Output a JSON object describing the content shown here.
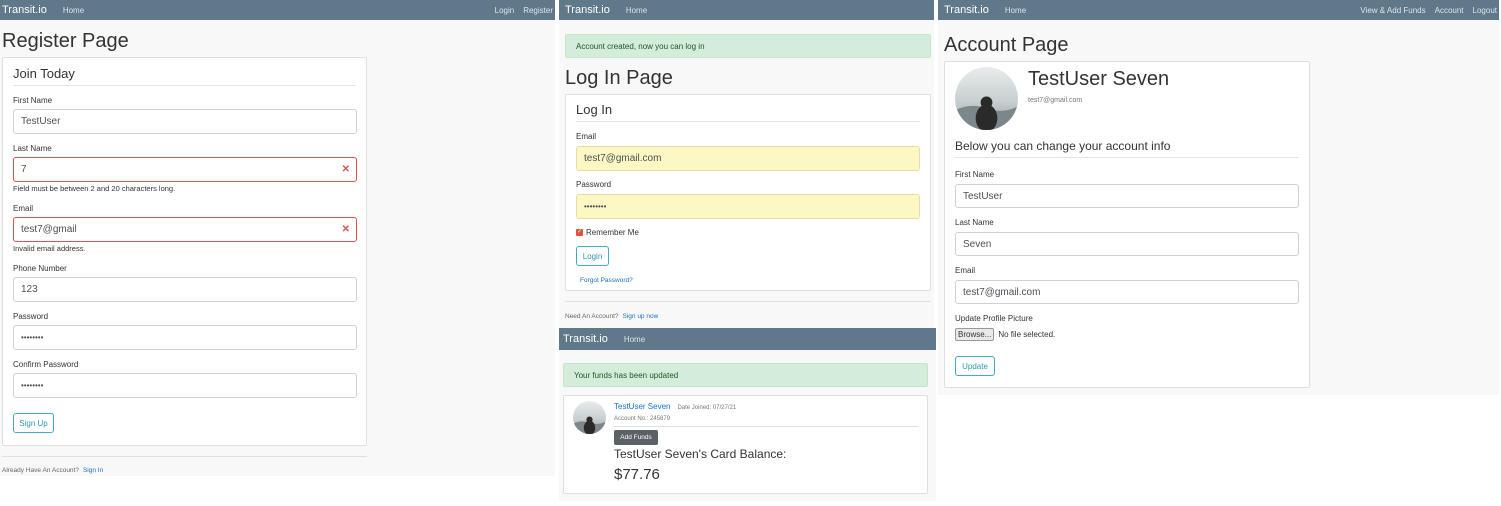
{
  "brand": "Transit.io",
  "nav": {
    "home": "Home",
    "login": "Login",
    "register": "Register",
    "view_add_funds": "View & Add Funds",
    "account": "Account",
    "logout": "Logout"
  },
  "register": {
    "title": "Register Page",
    "legend": "Join Today",
    "first_name_label": "First Name",
    "first_name_value": "TestUser",
    "last_name_label": "Last Name",
    "last_name_value": "7",
    "last_name_error": "Field must be between 2 and 20 characters long.",
    "email_label": "Email",
    "email_value": "test7@gmail",
    "email_error": "Invalid email address.",
    "phone_label": "Phone Number",
    "phone_value": "123",
    "password_label": "Password",
    "password_value": "••••••••",
    "confirm_label": "Confirm Password",
    "confirm_value": "••••••••",
    "submit": "Sign Up",
    "footer_text": "Already Have An Account?",
    "footer_link": "Sign In"
  },
  "login": {
    "alert": "Account created, now you can log in",
    "title": "Log In Page",
    "legend": "Log In",
    "email_label": "Email",
    "email_value": "test7@gmail.com",
    "password_label": "Password",
    "password_value": "••••••••",
    "remember": "Remember Me",
    "submit": "Login",
    "forgot": "Forgot Password?",
    "footer_text": "Need An Account?",
    "footer_link": "Sign up now"
  },
  "funds": {
    "alert": "Your funds has been updated",
    "user_name": "TestUser Seven",
    "date_joined": "Date Joined: 07/27/21",
    "account_no": "Account No.: 245879",
    "add_funds": "Add Funds",
    "balance_label": "TestUser Seven's Card Balance:",
    "balance": "$77.76"
  },
  "account": {
    "title": "Account Page",
    "user_name": "TestUser Seven",
    "user_email": "test7@gmail.com",
    "section": "Below you can change your account info",
    "first_name_label": "First Name",
    "first_name_value": "TestUser",
    "last_name_label": "Last Name",
    "last_name_value": "Seven",
    "email_label": "Email",
    "email_value": "test7@gmail.com",
    "picture_label": "Update Profile Picture",
    "browse": "Browse...",
    "no_file": "No file selected.",
    "submit": "Update"
  },
  "colors": {
    "navbar": "#5f788a",
    "accent": "#2b9cb0",
    "error": "#d9534f",
    "success_bg": "#d4edda",
    "autofill": "#fdf8c3"
  }
}
